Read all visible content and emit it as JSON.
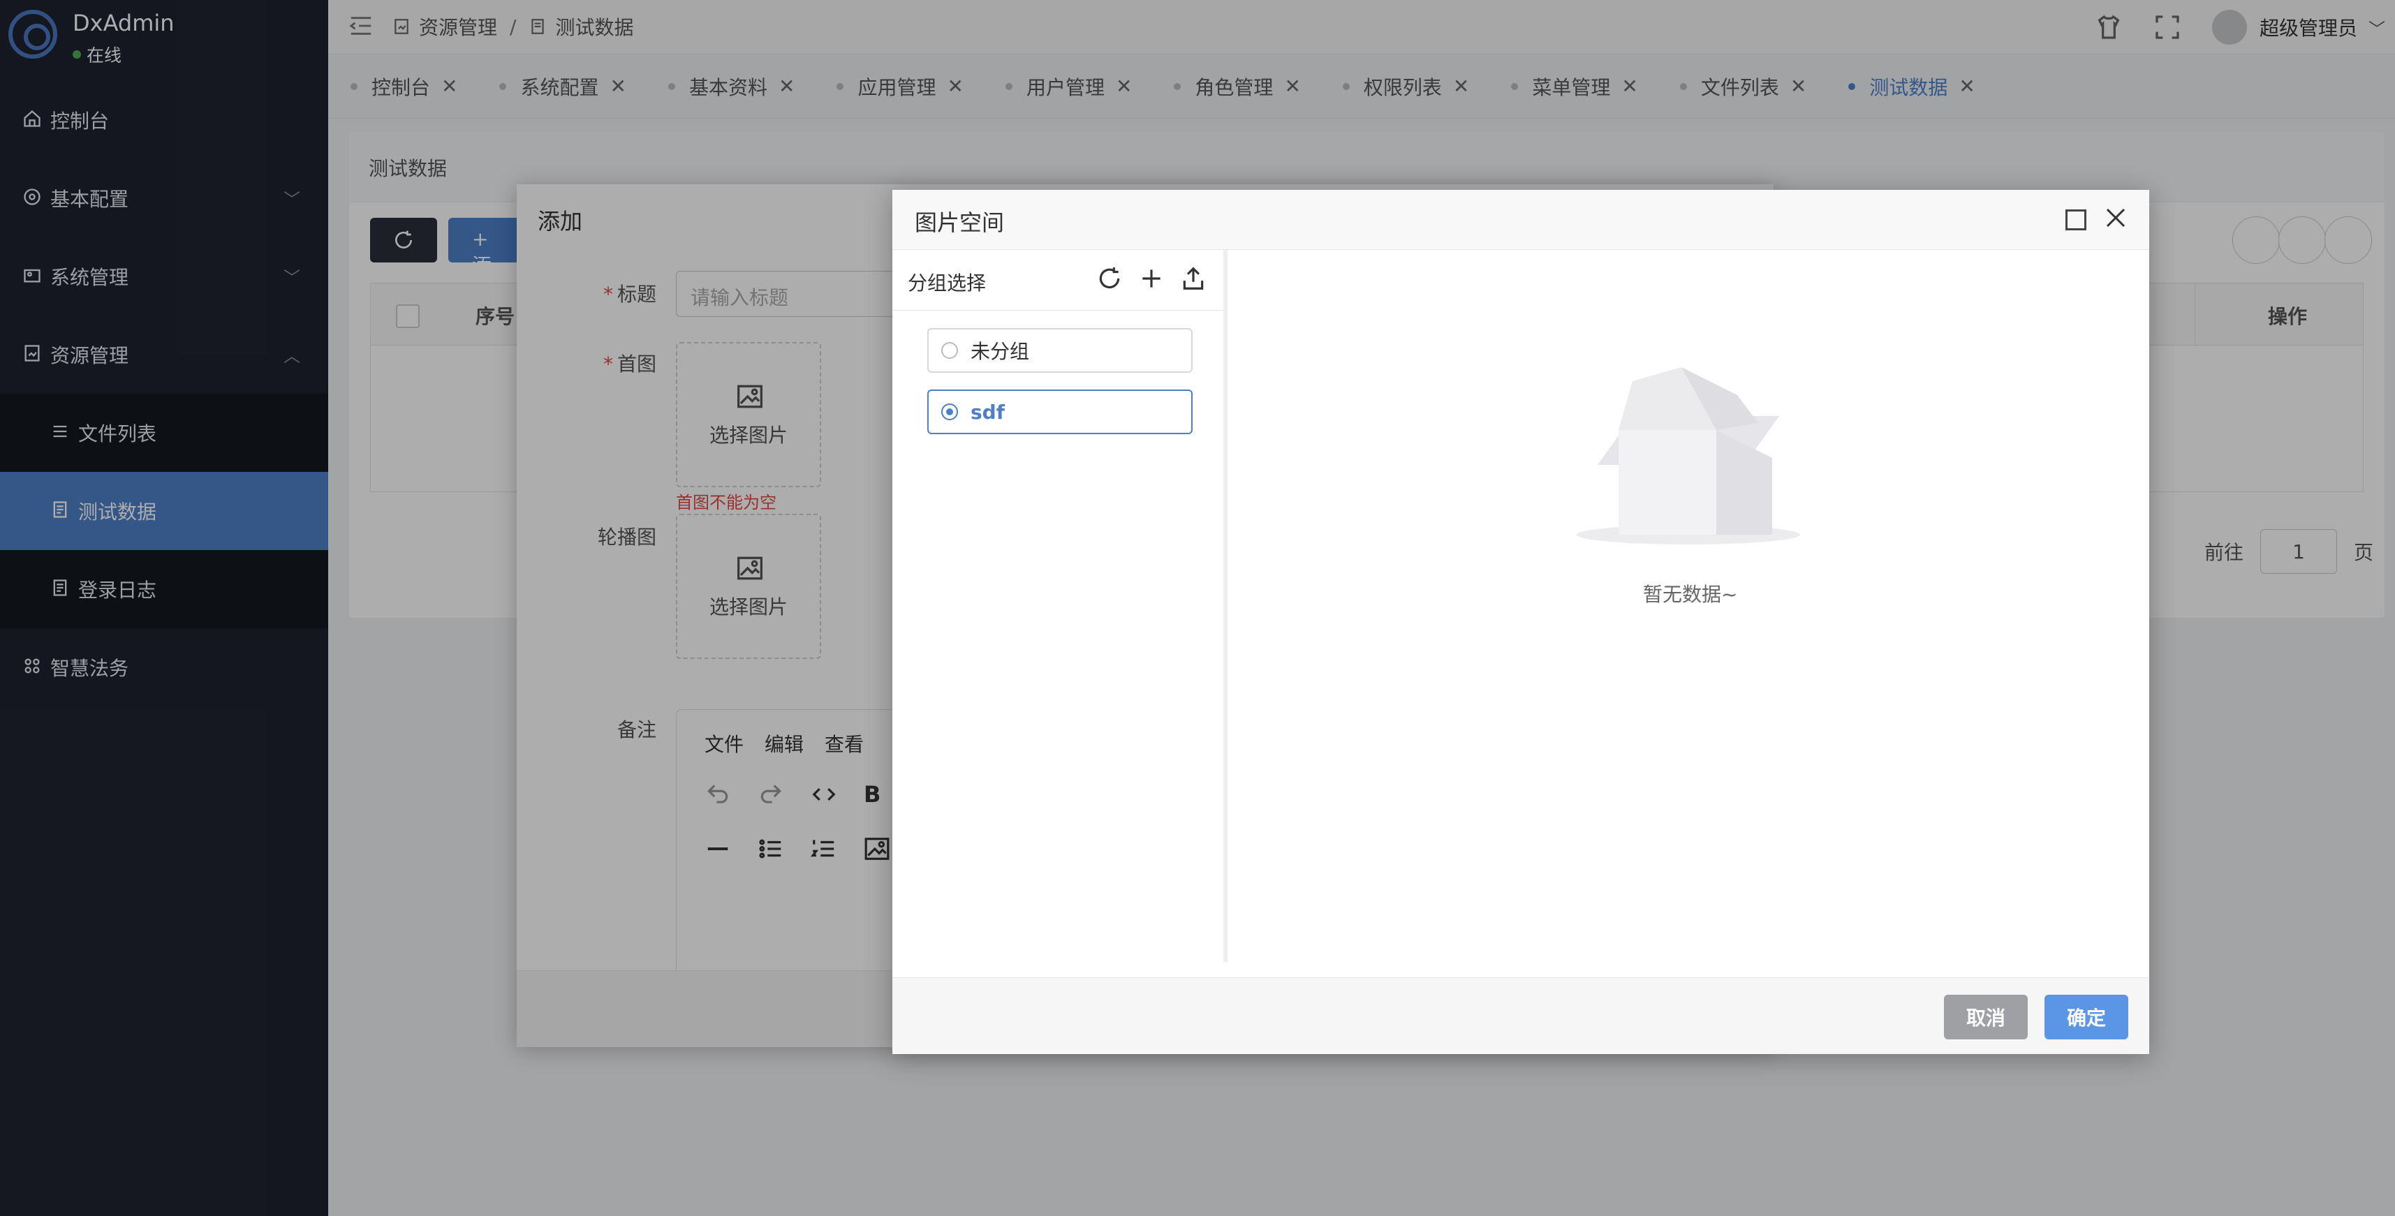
{
  "brand": {
    "title": "DxAdmin",
    "status": "在线"
  },
  "sidebar": {
    "items": [
      {
        "label": "控制台",
        "icon": "home-icon"
      },
      {
        "label": "基本配置",
        "icon": "gear-icon"
      },
      {
        "label": "系统管理",
        "icon": "system-icon"
      },
      {
        "label": "资源管理",
        "icon": "document-icon"
      },
      {
        "label": "文件列表",
        "icon": "list-icon"
      },
      {
        "label": "测试数据",
        "icon": "document-icon"
      },
      {
        "label": "登录日志",
        "icon": "document-icon"
      },
      {
        "label": "智慧法务",
        "icon": "grid-icon"
      }
    ]
  },
  "header": {
    "breadcrumb": [
      "资源管理",
      "测试数据"
    ],
    "breadcrumb_sep": "/",
    "username": "超级管理员"
  },
  "tabs": [
    "控制台",
    "系统配置",
    "基本资料",
    "应用管理",
    "用户管理",
    "角色管理",
    "权限列表",
    "菜单管理",
    "文件列表",
    "测试数据"
  ],
  "content": {
    "card_title": "测试数据",
    "add_button": "+ 添",
    "table_headers": {
      "seq": "序号",
      "op": "操作"
    },
    "pager": {
      "goto": "前往",
      "page_value": "1",
      "page_unit": "页"
    }
  },
  "add_dialog": {
    "title": "添加",
    "fields": {
      "title_label": "标题",
      "title_placeholder": "请输入标题",
      "cover_label": "首图",
      "select_image": "选择图片",
      "cover_error": "首图不能为空",
      "carousel_label": "轮播图",
      "remark_label": "备注"
    },
    "editor_menu": [
      "文件",
      "编辑",
      "查看"
    ],
    "bold": "B"
  },
  "image_space": {
    "title": "图片空间",
    "group_select": "分组选择",
    "groups": [
      {
        "label": "未分组",
        "selected": false
      },
      {
        "label": "sdf",
        "selected": true
      }
    ],
    "empty_text": "暂无数据~",
    "cancel": "取消",
    "confirm": "确定"
  },
  "colors": {
    "primary": "#4d80c9",
    "sidebar_bg": "#1f2330",
    "danger": "#e04848"
  }
}
